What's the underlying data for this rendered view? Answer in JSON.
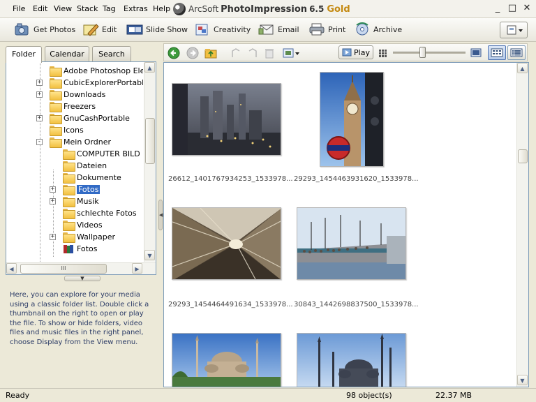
{
  "menu": {
    "items": [
      {
        "label": "File",
        "accel": "F"
      },
      {
        "label": "Edit",
        "accel": "E"
      },
      {
        "label": "View",
        "accel": "V"
      },
      {
        "label": "Stack",
        "accel": "S"
      },
      {
        "label": "Tag",
        "accel": "T"
      },
      {
        "label": "Extras",
        "accel": "x"
      },
      {
        "label": "Help",
        "accel": "H"
      }
    ]
  },
  "app": {
    "brand": "ArcSoft",
    "product": "PhotoImpression",
    "version": "6.5",
    "edition": "Gold"
  },
  "window_controls": {
    "minimize": "_",
    "maximize": "□",
    "close": "✕"
  },
  "toolbar": {
    "buttons": [
      {
        "label": "Get Photos",
        "icon": "get-photos-icon",
        "u": "G"
      },
      {
        "label": "Edit",
        "icon": "edit-icon",
        "u": "E"
      },
      {
        "label": "Slide Show",
        "icon": "slideshow-icon",
        "u": "S"
      },
      {
        "label": "Creativity",
        "icon": "creativity-icon",
        "u": "C"
      },
      {
        "label": "Email",
        "icon": "email-icon",
        "u": "E"
      },
      {
        "label": "Print",
        "icon": "print-icon",
        "u": "P"
      },
      {
        "label": "Archive",
        "icon": "archive-icon",
        "u": "A"
      }
    ]
  },
  "left": {
    "tabs": [
      "Folder",
      "Calendar",
      "Search"
    ],
    "active_tab": "Folder",
    "tree": [
      {
        "label": "Adobe Photoshop Elem",
        "expander": "",
        "selected": false
      },
      {
        "label": "CubicExplorerPortable",
        "expander": "+",
        "selected": false
      },
      {
        "label": "Downloads",
        "expander": "+",
        "selected": false
      },
      {
        "label": "Freezers",
        "expander": "",
        "selected": false
      },
      {
        "label": "GnuCashPortable",
        "expander": "+",
        "selected": false
      },
      {
        "label": "Icons",
        "expander": "",
        "selected": false
      },
      {
        "label": "Mein Ordner",
        "expander": "-",
        "selected": false
      },
      {
        "label": "COMPUTER BILD Lo",
        "expander": "",
        "selected": false
      },
      {
        "label": "Dateien",
        "expander": "",
        "selected": false
      },
      {
        "label": "Dokumente",
        "expander": "",
        "selected": false
      },
      {
        "label": "Fotos",
        "expander": "+",
        "selected": true
      },
      {
        "label": "Musik",
        "expander": "+",
        "selected": false
      },
      {
        "label": "schlechte Fotos",
        "expander": "",
        "selected": false
      },
      {
        "label": "Videos",
        "expander": "",
        "selected": false
      },
      {
        "label": "Wallpaper",
        "expander": "+",
        "selected": false
      },
      {
        "label": "Fotos",
        "expander": "",
        "selected": false
      }
    ],
    "help_text": "Here, you can explore for your media using a classic folder list. Double click a thumbnail on the right to open or play the file. To show or hide folders, video files and music files in the right panel, choose Display from the View menu.",
    "hscroll_grip": "III"
  },
  "right": {
    "play_label": "Play",
    "thumbnails": [
      {
        "caption": "26612_1401767934253_1533978...",
        "scene": "city-night"
      },
      {
        "caption": "29293_1454463931620_1533978...",
        "scene": "big-ben"
      },
      {
        "caption": "29293_1454464491634_1533978...",
        "scene": "escalator"
      },
      {
        "caption": "30843_1442698837500_1533978...",
        "scene": "bridge"
      },
      {
        "caption": "",
        "scene": "mosque-1"
      },
      {
        "caption": "",
        "scene": "mosque-2"
      }
    ]
  },
  "status": {
    "ready": "Ready",
    "count": "98 object(s)",
    "size": "22.37 MB"
  },
  "colors": {
    "selection": "#316ac5",
    "gold": "#c48a12",
    "window_bg": "#ece9d8"
  }
}
